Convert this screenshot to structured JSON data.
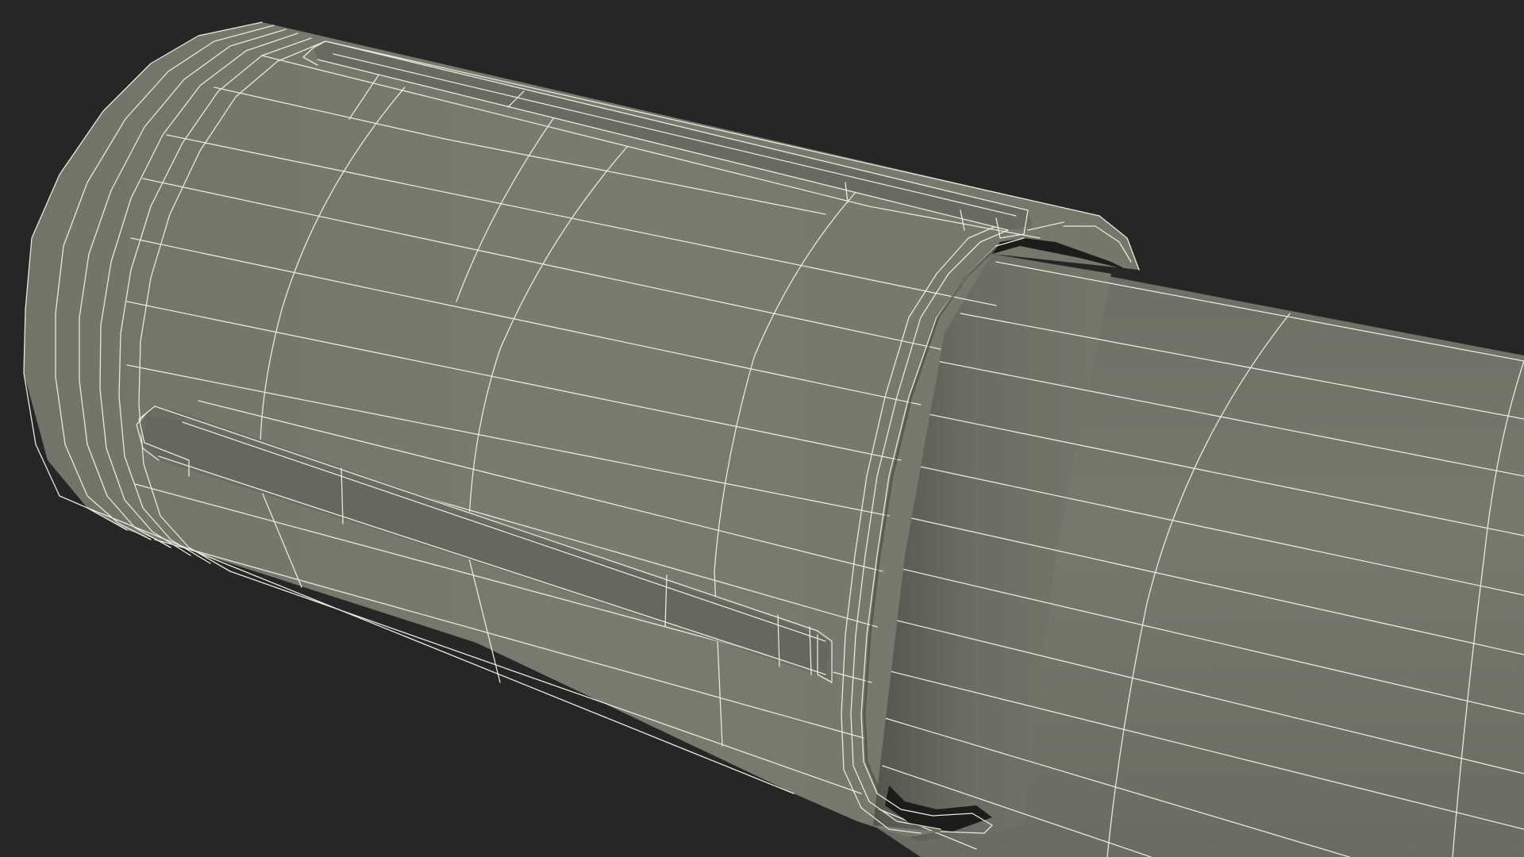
{
  "scene": {
    "subject": "wireframe-cylinder-assembly",
    "background_color": "#262626",
    "surface_color": "#77786c",
    "surface_shadow_color": "#5f6056",
    "inner_dark_color": "#1a1a18",
    "wire_color": "#e8e8dc"
  }
}
